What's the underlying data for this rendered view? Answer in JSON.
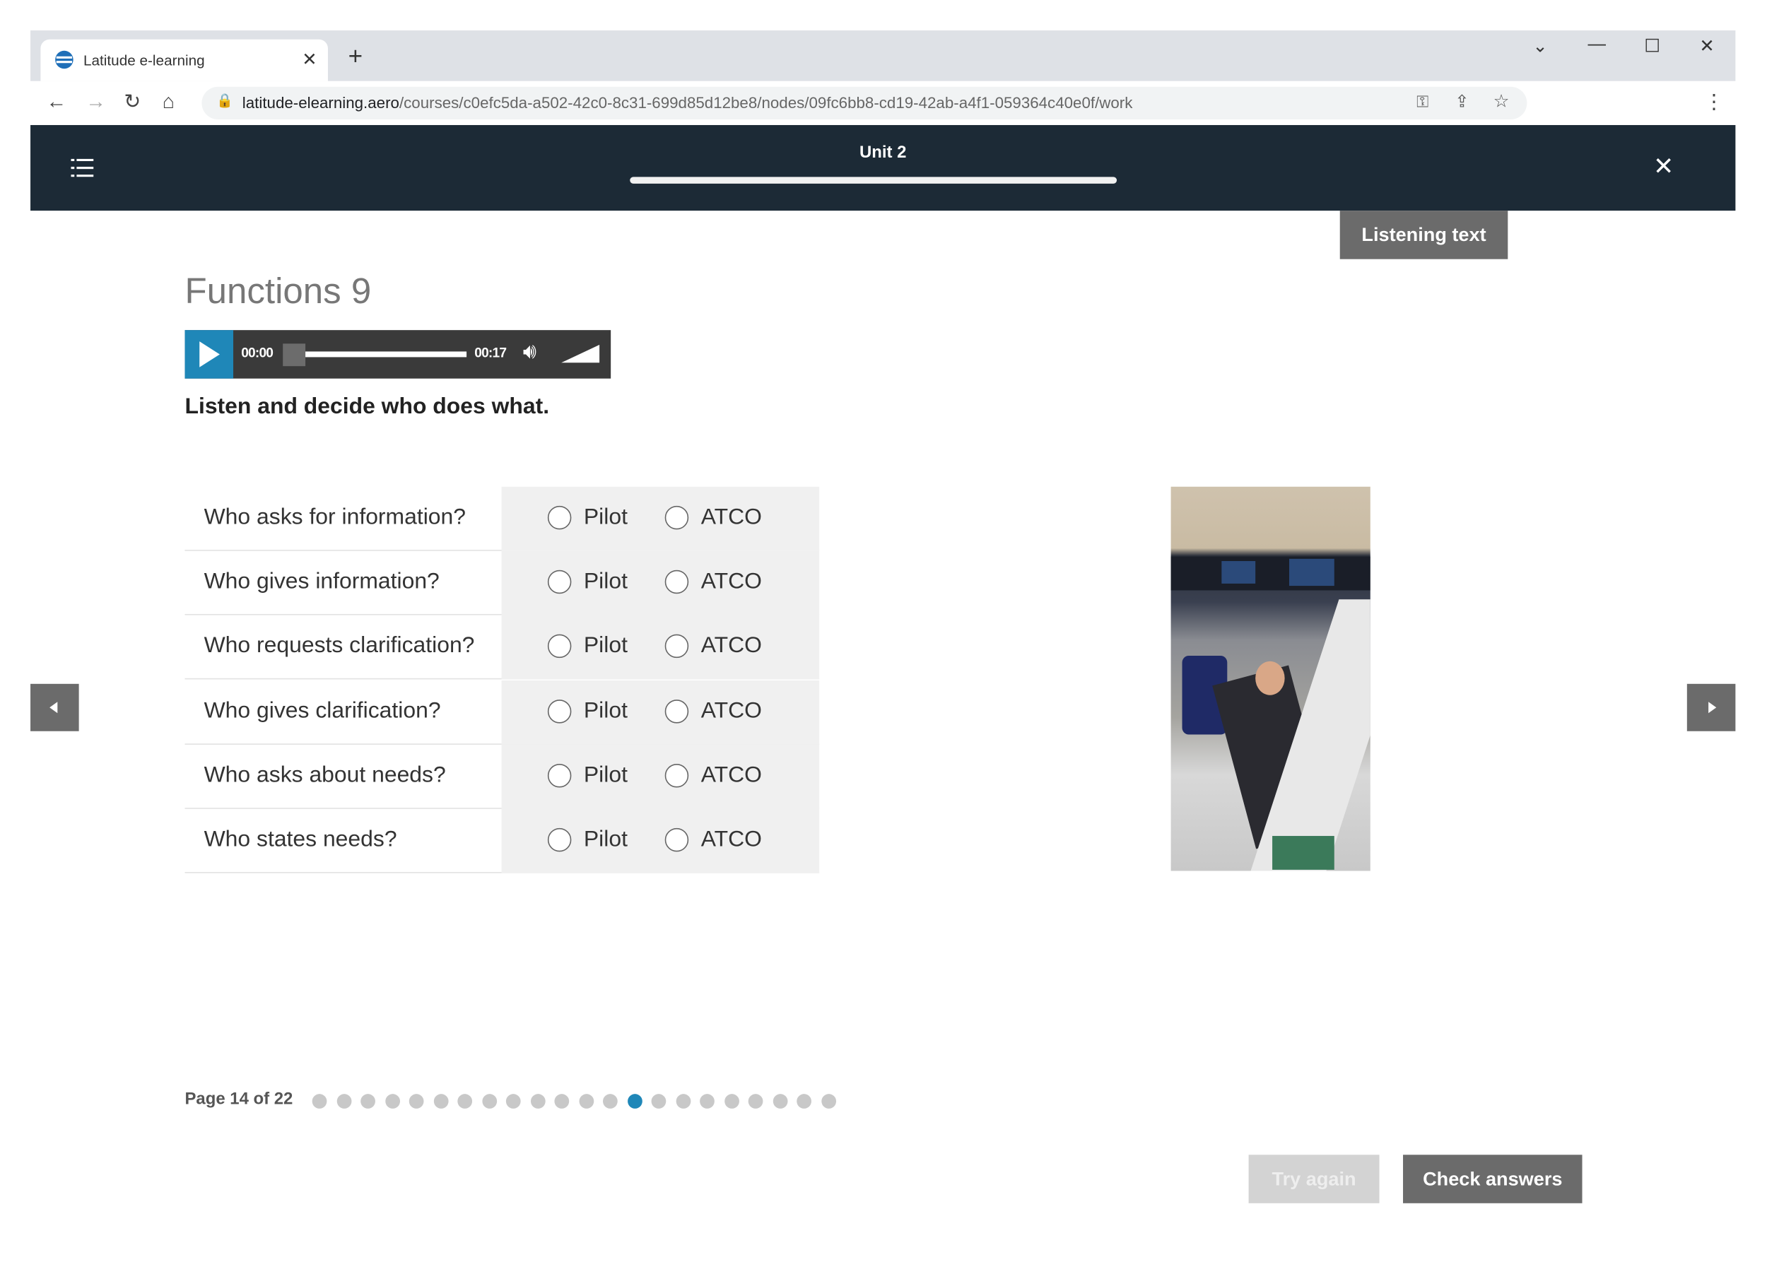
{
  "browser": {
    "tab_title": "Latitude e-learning",
    "url_host": "latitude-elearning.aero",
    "url_path": "/courses/c0efc5da-a502-42c0-8c31-699d85d12be8/nodes/09fc6bb8-cd19-42ab-a4f1-059364c40e0f/work"
  },
  "header": {
    "unit": "Unit 2",
    "progress": 1.0
  },
  "listening_text_label": "Listening text",
  "page_title": "Functions 9",
  "audio": {
    "current": "00:00",
    "duration": "00:17",
    "volume": 1.0
  },
  "instruction": "Listen and decide who does what.",
  "options": [
    "Pilot",
    "ATCO"
  ],
  "questions": [
    "Who asks for information?",
    "Who gives information?",
    "Who requests clarification?",
    "Who gives clarification?",
    "Who asks about needs?",
    "Who states needs?"
  ],
  "pagination": {
    "label": "Page 14 of 22",
    "current": 14,
    "total": 22
  },
  "buttons": {
    "try_again": "Try again",
    "check_answers": "Check answers"
  },
  "colors": {
    "accent": "#1f87b8",
    "header_bg": "#1c2a36",
    "button": "#6b6b6b"
  }
}
